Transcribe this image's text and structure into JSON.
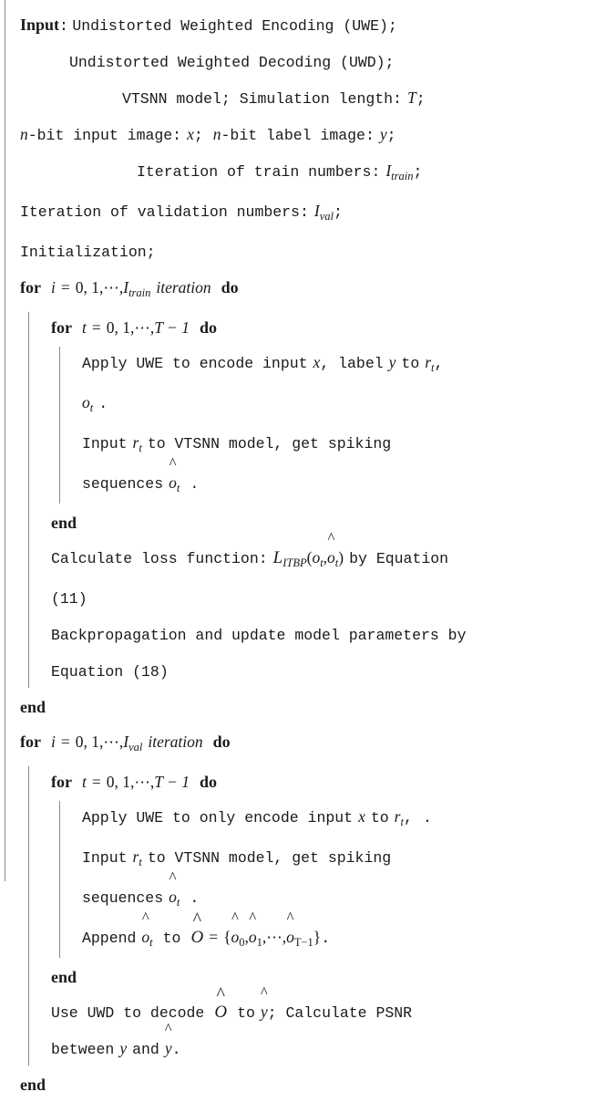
{
  "algorithm": {
    "type": "pseudocode-block",
    "font_note": "typewriter body with bold serif keywords and italic math",
    "input_header": {
      "label": "Input",
      "colon": ":",
      "lines": [
        "Undistorted Weighted Encoding (UWE);",
        "Undistorted Weighted Decoding (UWD);",
        "VTSNN model; Simulation length:",
        "n-bit input image:",
        "Iteration of train numbers:",
        "Iteration of validation numbers:",
        "Initialization;"
      ],
      "sim_length_var": "T",
      "sim_length_term": ";",
      "nbit_prefix": "n",
      "nbit_a": "-bit input image:",
      "nbit_x": "x",
      "nbit_semi": ";",
      "nbit_prefix2": "n",
      "nbit_b": "-bit label image:",
      "nbit_y": "y",
      "nbit_end": ";",
      "train_label": "Iteration of train numbers:",
      "train_var": "I",
      "train_sub": "train",
      "train_end": ";",
      "val_label": "Iteration of validation numbers:",
      "val_var": "I",
      "val_sub": "val",
      "val_end": ";",
      "init": "Initialization;"
    },
    "keywords": {
      "for": "for",
      "do": "do",
      "end": "end",
      "iteration": "iteration"
    },
    "train_loop": {
      "index": "i",
      "equals": "=",
      "range": "0, 1,",
      "dots": "⋯",
      "comma": ",",
      "bound_var": "I",
      "bound_sub": "train"
    },
    "time_loop": {
      "index": "t",
      "equals": "=",
      "range": "0, 1,",
      "dots": "⋯",
      "comma": ",",
      "bound": "T − 1"
    },
    "val_loop": {
      "index": "i",
      "equals": "=",
      "range": "0, 1,",
      "dots": "⋯",
      "comma": ",",
      "bound_var": "I",
      "bound_sub": "val"
    },
    "steps": {
      "apply_uwe_train_a": "Apply UWE to encode input",
      "apply_uwe_train_x": "x",
      "apply_uwe_train_b": ", label",
      "apply_uwe_train_y": "y",
      "apply_uwe_train_c": "to",
      "apply_uwe_train_r": "r",
      "apply_uwe_train_rsub": "t",
      "apply_uwe_train_comma": ",",
      "apply_uwe_train_o": "o",
      "apply_uwe_train_osub": "t",
      "apply_uwe_train_period": ".",
      "input_r_a": "Input",
      "input_r_var": "r",
      "input_r_sub": "t",
      "input_r_b": "to VTSNN model, get spiking",
      "sequences_label": "sequences",
      "sequences_var": "o",
      "sequences_sub": "t",
      "sequences_period": ".",
      "calc_loss_a": "Calculate loss function:",
      "calc_loss_L": "L",
      "calc_loss_Lsub": "ITBP",
      "calc_loss_args_open": "(",
      "calc_loss_o": "o",
      "calc_loss_osub": "t",
      "calc_loss_comma": ",",
      "calc_loss_ohat": "o",
      "calc_loss_ohatsub": "t",
      "calc_loss_args_close": ")",
      "calc_loss_b": "by Equation",
      "calc_loss_eq": "(11)",
      "backprop": "Backpropagation and update model parameters by",
      "backprop_eq": "Equation (18)",
      "apply_uwe_val_a": "Apply UWE to only encode input",
      "apply_uwe_val_x": "x",
      "apply_uwe_val_b": "to",
      "apply_uwe_val_r": "r",
      "apply_uwe_val_rsub": "t",
      "apply_uwe_val_comma": ",",
      "apply_uwe_val_period": ".",
      "append_a": "Append",
      "append_ohat": "o",
      "append_ohatsub": "t",
      "append_b": "to",
      "append_O": "O",
      "append_eq": "=",
      "append_brace_open": "{",
      "append_o0": "o",
      "append_o0sub": "0",
      "append_c1": ",",
      "append_o1": "o",
      "append_o1sub": "1",
      "append_c2": ",",
      "append_dots": "⋯",
      "append_c3": ",",
      "append_oT": "o",
      "append_oTsub": "T−1",
      "append_brace_close": "}",
      "append_period": ".",
      "decode_a": "Use UWD to decode",
      "decode_O": "O",
      "decode_b": "to",
      "decode_yhat": "y",
      "decode_semi": "; Calculate PSNR",
      "decode_c": "between",
      "decode_y": "y",
      "decode_d": "and",
      "decode_yhat2": "y",
      "decode_period": "."
    }
  }
}
